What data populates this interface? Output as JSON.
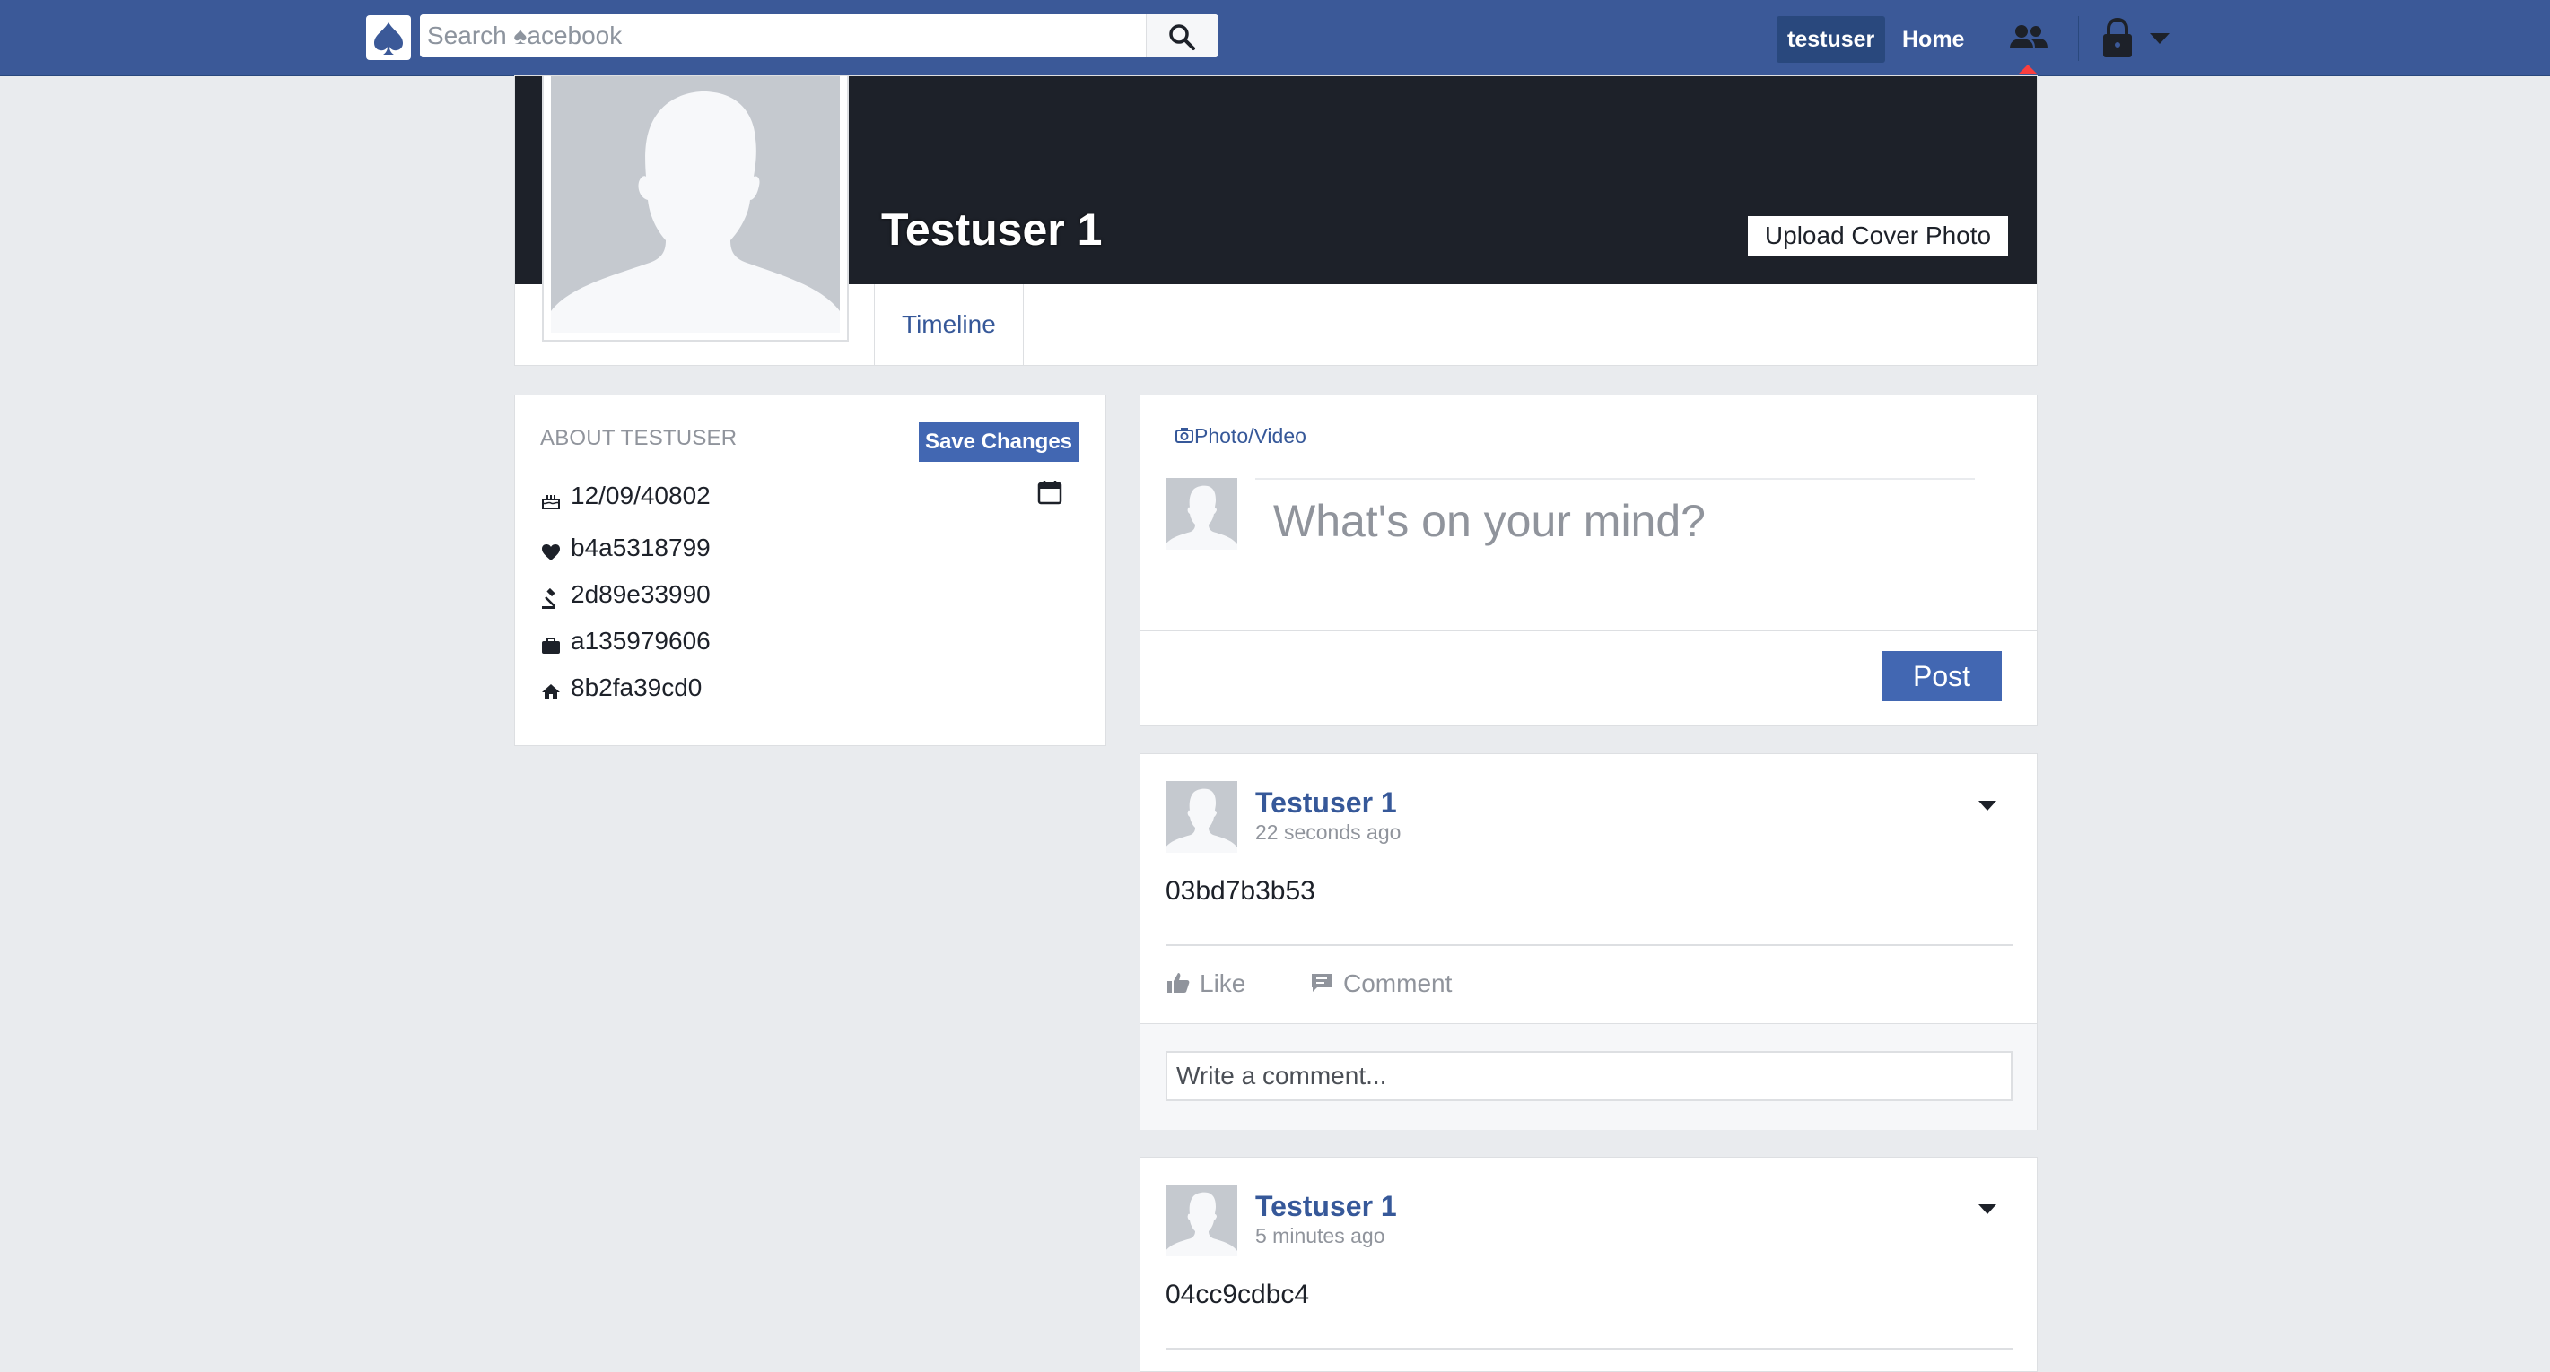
{
  "topbar": {
    "logo_icon": "spade-icon",
    "search_placeholder": "Search ♠acebook",
    "search_icon": "search-icon",
    "username": "testuser",
    "home_label": "Home",
    "friends_icon": "friends-icon",
    "lock_icon": "lock-icon",
    "notification_color": "#fa3e3e"
  },
  "profile": {
    "name": "Testuser 1",
    "upload_cover_label": "Upload Cover Photo",
    "tabs": [
      {
        "label": "Timeline"
      }
    ]
  },
  "about": {
    "title": "ABOUT TESTUSER",
    "save_label": "Save Changes",
    "rows": [
      {
        "icon": "cake-icon",
        "value": "12/09/40802"
      },
      {
        "icon": "heart-icon",
        "value": "b4a5318799"
      },
      {
        "icon": "gavel-icon",
        "value": "2d89e33990"
      },
      {
        "icon": "briefcase-icon",
        "value": "a135979606"
      },
      {
        "icon": "home-icon",
        "value": "8b2fa39cd0"
      }
    ]
  },
  "composer": {
    "photo_video_label": "Photo/Video",
    "placeholder": "What's on your mind?",
    "post_label": "Post"
  },
  "posts": [
    {
      "author": "Testuser 1",
      "time": "22 seconds ago",
      "text": "03bd7b3b53",
      "like_label": "Like",
      "comment_label": "Comment",
      "comment_placeholder": "Write a comment..."
    },
    {
      "author": "Testuser 1",
      "time": "5 minutes ago",
      "text": "04cc9cdbc4"
    }
  ],
  "colors": {
    "brand": "#3b5998",
    "button": "#4267b2",
    "link": "#365899",
    "cover": "#1d2129",
    "background": "#e9ebee"
  }
}
